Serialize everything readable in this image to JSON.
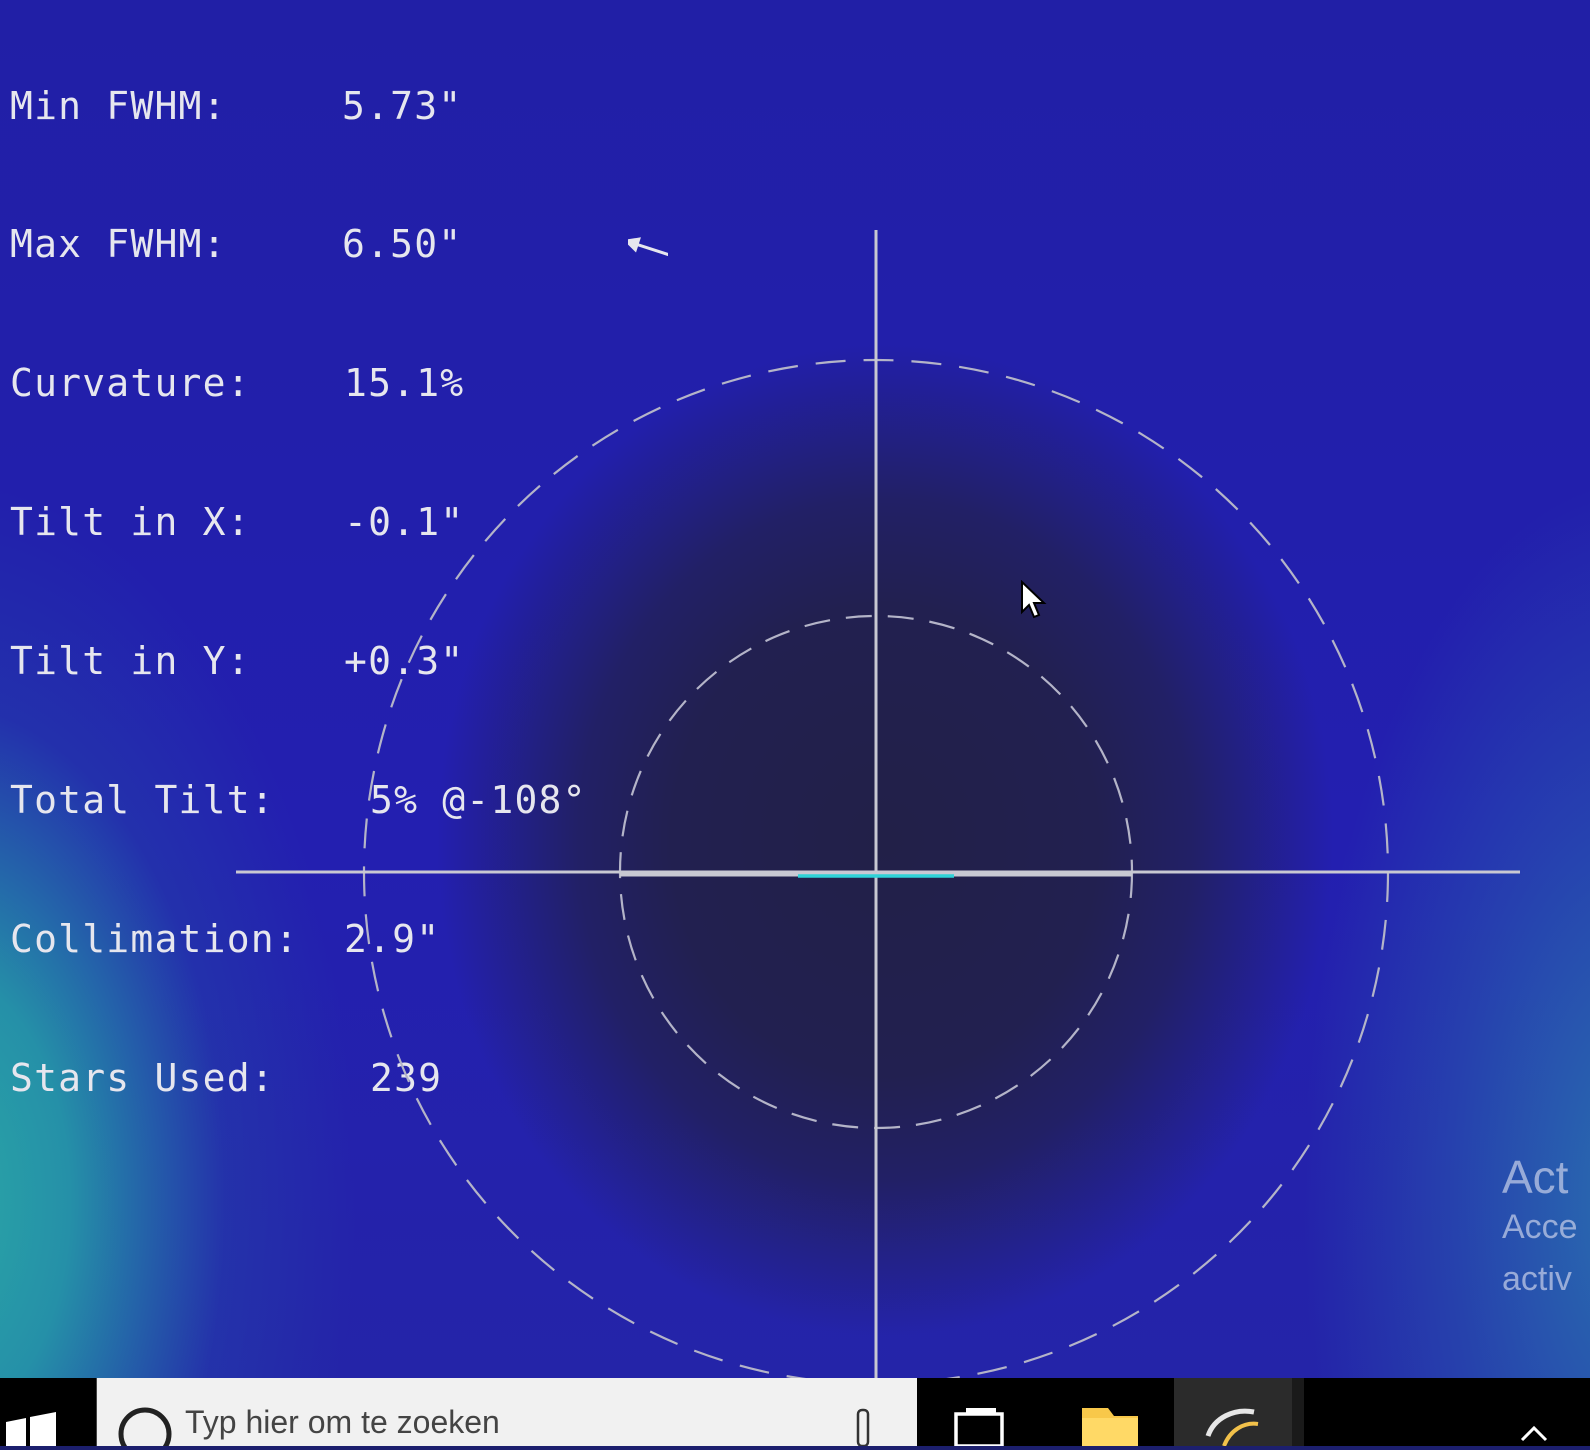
{
  "stats": [
    {
      "label": "Min FWHM:",
      "value": "5.73\""
    },
    {
      "label": "Max FWHM:",
      "value": "6.50\""
    },
    {
      "label": "Curvature:",
      "value": "15.1%"
    },
    {
      "label": "Tilt in X:",
      "value": "-0.1\""
    },
    {
      "label": "Tilt in Y:",
      "value": "+0.3\""
    },
    {
      "label": "Total Tilt:",
      "value": "5% @-108°"
    },
    {
      "label": "Collimation:",
      "value": "2.9\""
    },
    {
      "label": "Stars Used:",
      "value": "239"
    }
  ],
  "total_tilt_angle_deg": -108,
  "colors": {
    "text": "#e6e6ee",
    "crosshair": "#c8c8d2",
    "circle_dashes": "#b4b4c8",
    "collimation_marker": "#2ed3d8",
    "background_center": "#222048",
    "background_edge": "#231fb0"
  },
  "activation_watermark": {
    "title": "Act",
    "line1": "Acce",
    "line2": "activ"
  },
  "taskbar": {
    "search_placeholder": "Typ hier om te zoeken",
    "icons": [
      "windows-start-icon",
      "search-icon",
      "microphone-icon",
      "task-view-icon",
      "file-explorer-icon",
      "app-icon",
      "tray-chevron-icon"
    ]
  }
}
